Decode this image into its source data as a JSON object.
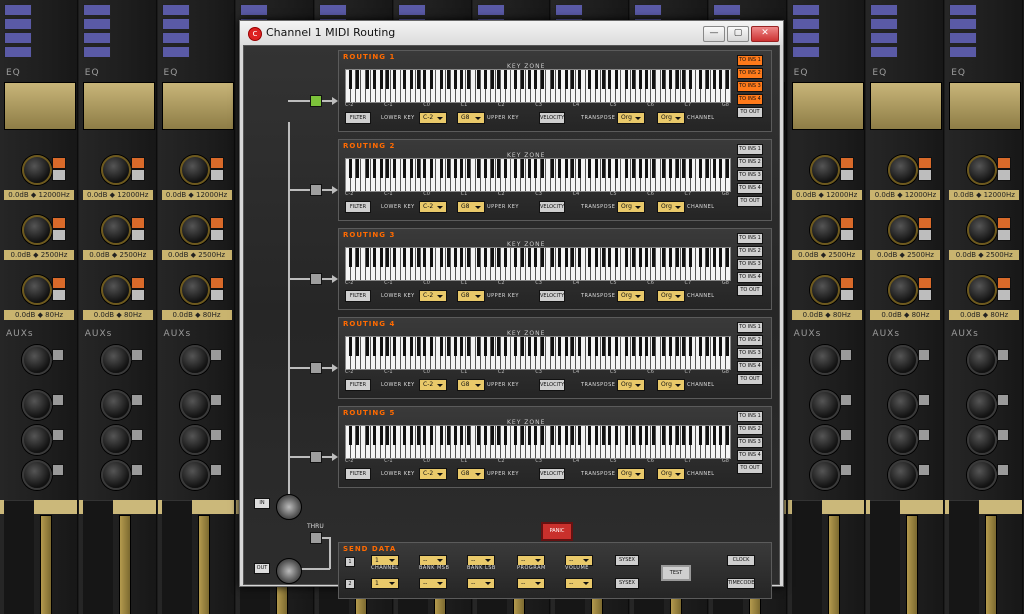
{
  "window": {
    "title": "Channel 1 MIDI Routing",
    "minimize": "—",
    "maximize": "▢",
    "close": "✕"
  },
  "mixer": {
    "eq_label": "EQ",
    "aux_label": "AUXs",
    "freq_values": [
      "0.0dB ◆ 12000Hz",
      "0.0dB ◆ 2500Hz",
      "0.0dB ◆ 80Hz"
    ]
  },
  "routing_blocks": [
    {
      "title": "ROUTING 1",
      "key_zone": "KEY ZONE",
      "filter": "FILTER",
      "lower_key_label": "LOWER KEY",
      "lower_key": "C-2",
      "upper_key": "G8",
      "upper_key_label": "UPPER KEY",
      "velocity": "VELOCITY",
      "transpose_label": "TRANSPOSE",
      "transpose": "Org",
      "channel": "Org",
      "channel_label": "CHANNEL",
      "outputs": [
        "TO INS 1",
        "TO INS 2",
        "TO INS 3",
        "TO INS 4",
        "TO OUT"
      ],
      "active_outputs": [
        true,
        true,
        true,
        true,
        false
      ],
      "enabled": true
    },
    {
      "title": "ROUTING 2",
      "key_zone": "KEY ZONE",
      "filter": "FILTER",
      "lower_key_label": "LOWER KEY",
      "lower_key": "C-2",
      "upper_key": "G8",
      "upper_key_label": "UPPER KEY",
      "velocity": "VELOCITY",
      "transpose_label": "TRANSPOSE",
      "transpose": "Org",
      "channel": "Org",
      "channel_label": "CHANNEL",
      "outputs": [
        "TO INS 1",
        "TO INS 2",
        "TO INS 3",
        "TO INS 4",
        "TO OUT"
      ],
      "active_outputs": [
        false,
        false,
        false,
        false,
        false
      ],
      "enabled": false
    },
    {
      "title": "ROUTING 3",
      "key_zone": "KEY ZONE",
      "filter": "FILTER",
      "lower_key_label": "LOWER KEY",
      "lower_key": "C-2",
      "upper_key": "G8",
      "upper_key_label": "UPPER KEY",
      "velocity": "VELOCITY",
      "transpose_label": "TRANSPOSE",
      "transpose": "Org",
      "channel": "Org",
      "channel_label": "CHANNEL",
      "outputs": [
        "TO INS 1",
        "TO INS 2",
        "TO INS 3",
        "TO INS 4",
        "TO OUT"
      ],
      "active_outputs": [
        false,
        false,
        false,
        false,
        false
      ],
      "enabled": false
    },
    {
      "title": "ROUTING 4",
      "key_zone": "KEY ZONE",
      "filter": "FILTER",
      "lower_key_label": "LOWER KEY",
      "lower_key": "C-2",
      "upper_key": "G8",
      "upper_key_label": "UPPER KEY",
      "velocity": "VELOCITY",
      "transpose_label": "TRANSPOSE",
      "transpose": "Org",
      "channel": "Org",
      "channel_label": "CHANNEL",
      "outputs": [
        "TO INS 1",
        "TO INS 2",
        "TO INS 3",
        "TO INS 4",
        "TO OUT"
      ],
      "active_outputs": [
        false,
        false,
        false,
        false,
        false
      ],
      "enabled": false
    },
    {
      "title": "ROUTING 5",
      "key_zone": "KEY ZONE",
      "filter": "FILTER",
      "lower_key_label": "LOWER KEY",
      "lower_key": "C-2",
      "upper_key": "G8",
      "upper_key_label": "UPPER KEY",
      "velocity": "VELOCITY",
      "transpose_label": "TRANSPOSE",
      "transpose": "Org",
      "channel": "Org",
      "channel_label": "CHANNEL",
      "outputs": [
        "TO INS 1",
        "TO INS 2",
        "TO INS 3",
        "TO INS 4",
        "TO OUT"
      ],
      "active_outputs": [
        false,
        false,
        false,
        false,
        false
      ],
      "enabled": false
    }
  ],
  "octaves": [
    "C-2",
    "C-1",
    "C0",
    "C1",
    "C2",
    "C3",
    "C4",
    "C5",
    "C6",
    "C7",
    "G8"
  ],
  "io": {
    "in": "IN",
    "thru": "THRU",
    "out": "OUT",
    "panic": "PANIC"
  },
  "send_data": {
    "title": "SEND DATA",
    "rows": [
      "1",
      "2"
    ],
    "labels": [
      "CHANNEL",
      "BANK MSB",
      "BANK LSB",
      "PROGRAM",
      "VOLUME"
    ],
    "row1": [
      "1",
      "--",
      "--",
      "--",
      "--"
    ],
    "row2": [
      "1",
      "--",
      "--",
      "--",
      "--"
    ],
    "sysex": "SYSEX",
    "test": "TEST",
    "clock": "CLOCK",
    "timecode": "TIMECODE"
  },
  "colors": {
    "accent": "#ff6a00",
    "active_toggle": "#7cc23a",
    "dropdown": "#e9c96a",
    "panic": "#c9302c"
  }
}
